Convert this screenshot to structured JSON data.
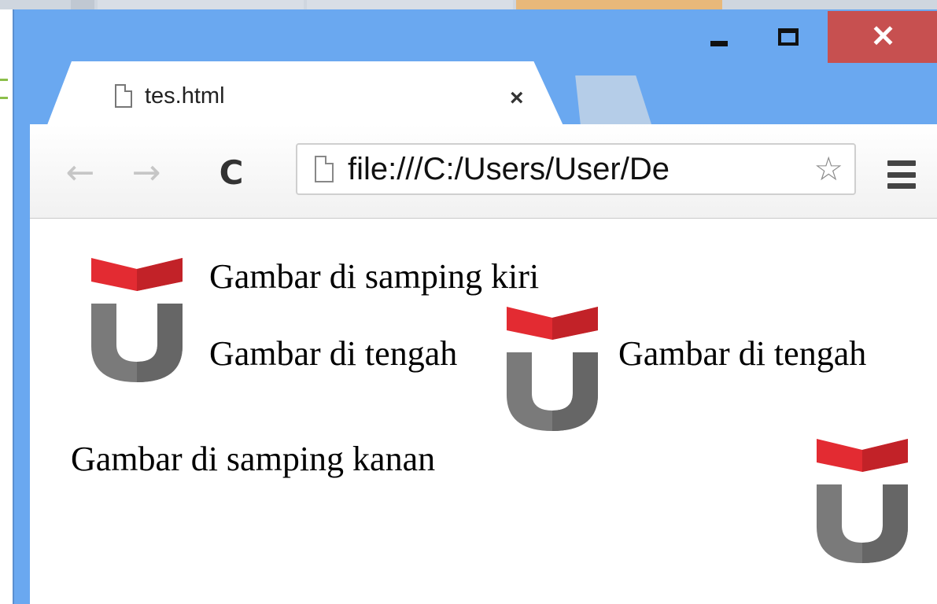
{
  "window": {
    "minimize_label": "_",
    "maximize_label": "□",
    "close_label": "✕"
  },
  "tab": {
    "title": "tes.html",
    "close_label": "×",
    "icon": "file-icon"
  },
  "toolbar": {
    "back_icon": "←",
    "forward_icon": "→",
    "reload_icon": "C",
    "url": "file:///C:/Users/User/De",
    "star_icon": "☆"
  },
  "page": {
    "text_left": "Gambar di samping kiri",
    "text_middle_left": "Gambar di tengah",
    "text_middle_right": "Gambar di tengah",
    "text_right": "Gambar di samping kanan"
  },
  "colors": {
    "title_bar": "#6aa8f0",
    "close_button": "#c75050",
    "logo_red": "#e32b32",
    "logo_gray": "#7a7a7a"
  }
}
